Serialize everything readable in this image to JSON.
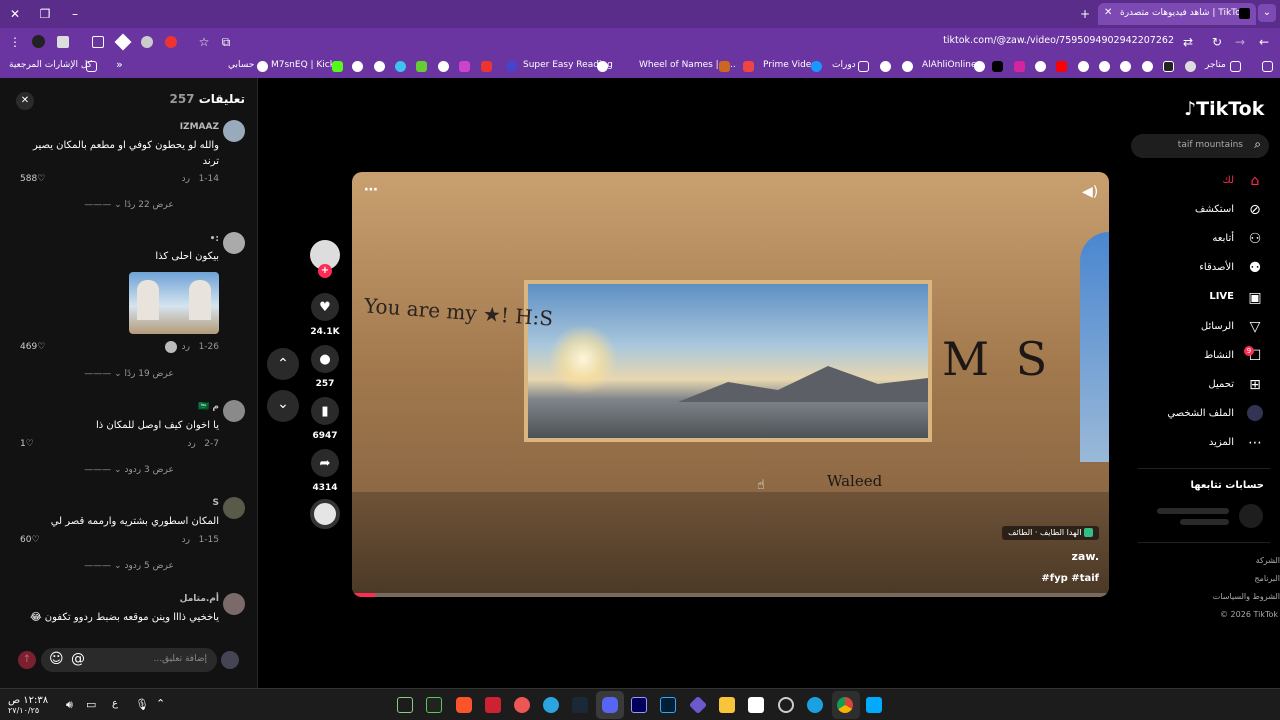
{
  "browser": {
    "tab_title": "شاهد فيديوهات متصدرة | TikTok",
    "url": "tiktok.com/@zaw./video/7595094902942207262",
    "bookmarks": [
      "كل الإشارات المرجعية",
      "حسابي",
      "M7snEQ | Kick",
      "Super Easy Reading",
      "Wheel of Names | م...",
      "Prime Video",
      "دورات",
      "AlAhliOnline",
      "متاجر"
    ]
  },
  "sidebar": {
    "logo": "TikTok",
    "search_placeholder": "taif mountains",
    "items": [
      {
        "label": "لك",
        "icon": "home-icon"
      },
      {
        "label": "استكشف",
        "icon": "compass-icon"
      },
      {
        "label": "أتابعه",
        "icon": "user-follow-icon"
      },
      {
        "label": "الأصدقاء",
        "icon": "friends-icon"
      },
      {
        "label": "LIVE",
        "icon": "live-icon"
      },
      {
        "label": "الرسائل",
        "icon": "send-icon"
      },
      {
        "label": "النشاط",
        "icon": "activity-icon"
      },
      {
        "label": "تحميل",
        "icon": "upload-icon"
      },
      {
        "label": "الملف الشخصي",
        "icon": "profile-icon"
      },
      {
        "label": "المزيد",
        "icon": "more-icon"
      }
    ],
    "following_title": "حسابات تتابعها",
    "footer": [
      "الشركة",
      "البرنامج",
      "الشروط والسياسات",
      "© 2026 TikTok"
    ],
    "activity_badge": "9"
  },
  "comments_panel": {
    "title": "تعليقات",
    "count": "257",
    "input_placeholder": "إضافة تعليق...",
    "comments": [
      {
        "user": "IZMAAZ",
        "text": "والله لو يحطون كوفي او مطعم بالمكان يصير ترند",
        "date": "1-14",
        "reply": "رد",
        "likes": "588",
        "view_replies": "عرض 22 ردًا"
      },
      {
        "user": ":•",
        "text": "بيكون احلى كذا",
        "date": "1-26",
        "reply": "رد",
        "likes": "469",
        "view_replies": "عرض 19 ردًا"
      },
      {
        "user": "م 🇸🇦",
        "text": "يا اخوان كيف اوصل للمكان ذا",
        "date": "2-7",
        "reply": "رد",
        "likes": "1",
        "view_replies": "عرض 3 ردود"
      },
      {
        "user": "S",
        "text": "المكان اسطوري بشتريه وارممه قصر لي",
        "date": "1-15",
        "reply": "رد",
        "likes": "60",
        "view_replies": "عرض 5 ردود"
      },
      {
        "user": "أم.متامل",
        "text": "ياخخيي ذااا وينن موقعه بضبط ردوو تكفون 😂",
        "date": "",
        "reply": "",
        "likes": "",
        "view_replies": ""
      }
    ]
  },
  "video": {
    "location": "الهدا الطايف · الطائف",
    "author": "zaw.",
    "caption": "#fyp #taif",
    "progress": 0.03
  },
  "actions": {
    "likes": "24.1K",
    "comments": "257",
    "saves": "6947",
    "shares": "4314"
  },
  "taskbar": {
    "time": "١٢:٣٨ ص",
    "date": "٢٧/١٠/٢٥",
    "lang": "ع"
  }
}
